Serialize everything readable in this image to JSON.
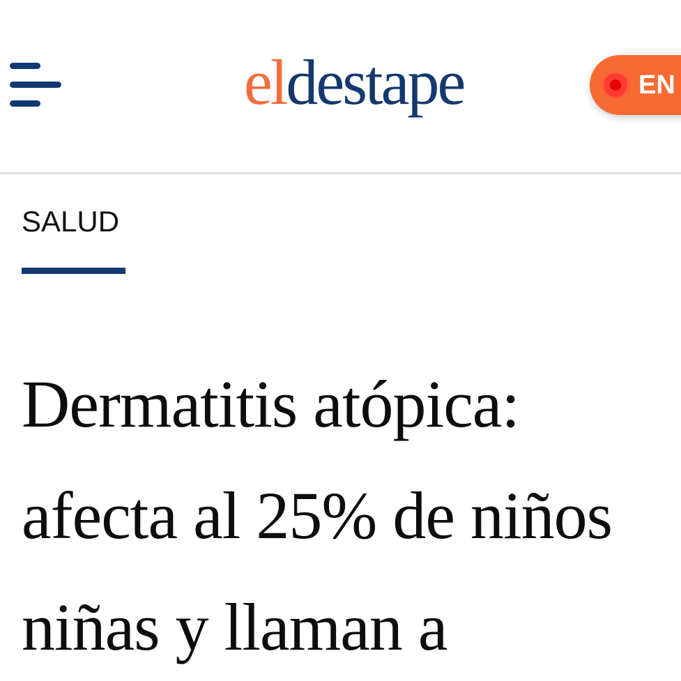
{
  "header": {
    "logo": {
      "part_el": "el",
      "part_destape": "destape",
      "colors": {
        "el": "#f26d3d",
        "destape": "#14396e"
      }
    },
    "live_button": {
      "label": "EN V",
      "color": "#f76a32"
    },
    "menu_icon": "hamburger-menu-icon"
  },
  "article": {
    "section": "SALUD",
    "headline_lines": [
      "Dermatitis atópica:",
      "afecta al 25% de niños",
      "niñas y llaman a"
    ]
  },
  "colors": {
    "brand_navy": "#14396e",
    "brand_orange": "#f26d3d",
    "text": "#0d0d0d"
  }
}
